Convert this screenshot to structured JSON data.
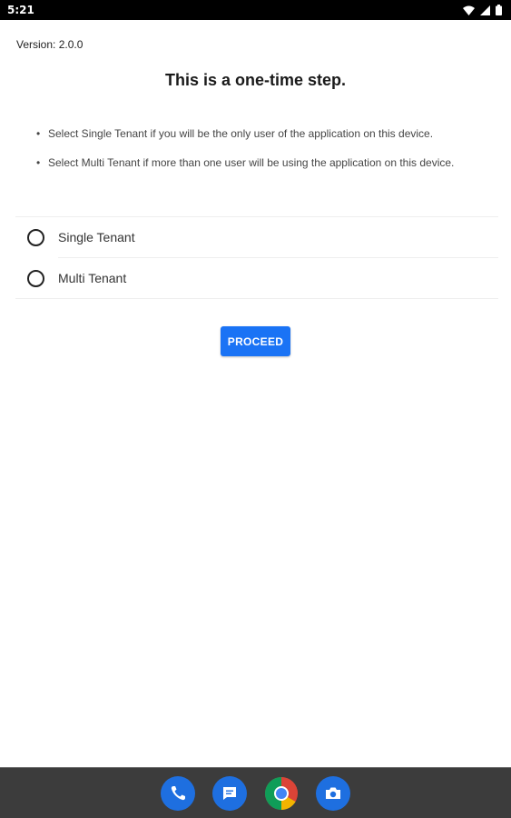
{
  "status_bar": {
    "time": "5:21",
    "icons": [
      "wifi-icon",
      "signal-icon",
      "battery-icon"
    ]
  },
  "screen": {
    "version": "Version: 2.0.0",
    "title": "This is a one-time step.",
    "instructions": [
      "Select Single Tenant if you will be the only user of the application on this device.",
      "Select Multi Tenant if more than one user will be using the application on this device."
    ],
    "options": [
      {
        "label": "Single Tenant",
        "selected": false
      },
      {
        "label": "Multi Tenant",
        "selected": false
      }
    ],
    "proceed_label": "PROCEED"
  },
  "dock": {
    "apps": [
      "phone-icon",
      "messages-icon",
      "chrome-icon",
      "camera-icon"
    ]
  },
  "colors": {
    "accent": "#1a73f5",
    "status_bar": "#000000",
    "dock": "#3c3c3c"
  }
}
